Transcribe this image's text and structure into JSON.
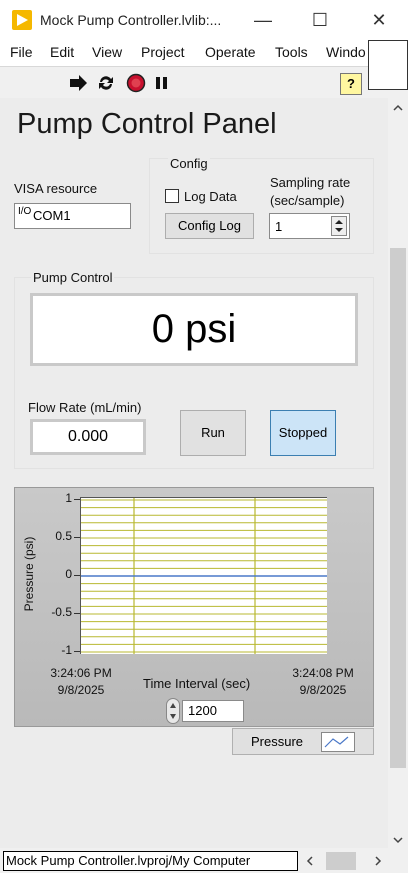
{
  "window": {
    "title": "Mock Pump Controller.lvlib:...",
    "controls": {
      "minimize": "—",
      "maximize": "☐",
      "close": "✕"
    }
  },
  "menu": [
    "File",
    "Edit",
    "View",
    "Project",
    "Operate",
    "Tools",
    "Windo"
  ],
  "toolbar": {
    "help_label": "?"
  },
  "panel": {
    "title": "Pump Control Panel",
    "visa": {
      "label": "VISA resource",
      "icon_text": "I/O",
      "value": "COM1"
    },
    "config": {
      "group_label": "Config",
      "log_data_label": "Log Data",
      "log_data_checked": false,
      "config_log_button": "Config Log",
      "sampling_label_line1": "Sampling rate",
      "sampling_label_line2": "(sec/sample)",
      "sampling_value": "1"
    },
    "pump": {
      "group_label": "Pump Control",
      "pressure_display": "0 psi",
      "flow_label": "Flow Rate (mL/min)",
      "flow_value": "0.000",
      "run_button": "Run",
      "stopped_button": "Stopped"
    }
  },
  "chart_data": {
    "type": "line",
    "ylabel": "Pressure (psi)",
    "xlabel": "Time Interval (sec)",
    "ylim": [
      -1,
      1
    ],
    "yticks": [
      "1",
      "0.5",
      "0",
      "-0.5",
      "-1"
    ],
    "x_start_time": "3:24:06 PM",
    "x_start_date": "9/8/2025",
    "x_end_time": "3:24:08 PM",
    "x_end_date": "9/8/2025",
    "series": [
      {
        "name": "Pressure",
        "values": [
          0,
          0
        ],
        "color": "#4a78c8"
      }
    ],
    "grid": true,
    "grid_color": "#b8b830",
    "time_interval_value": "1200",
    "legend": "bottom-right"
  },
  "statusbar": {
    "path": "Mock Pump Controller.lvproj/My Computer"
  },
  "colors": {
    "stopped_button_bg": "#cce4f7",
    "stopped_button_border": "#3c7fb1",
    "app_icon": "#f5b800"
  }
}
